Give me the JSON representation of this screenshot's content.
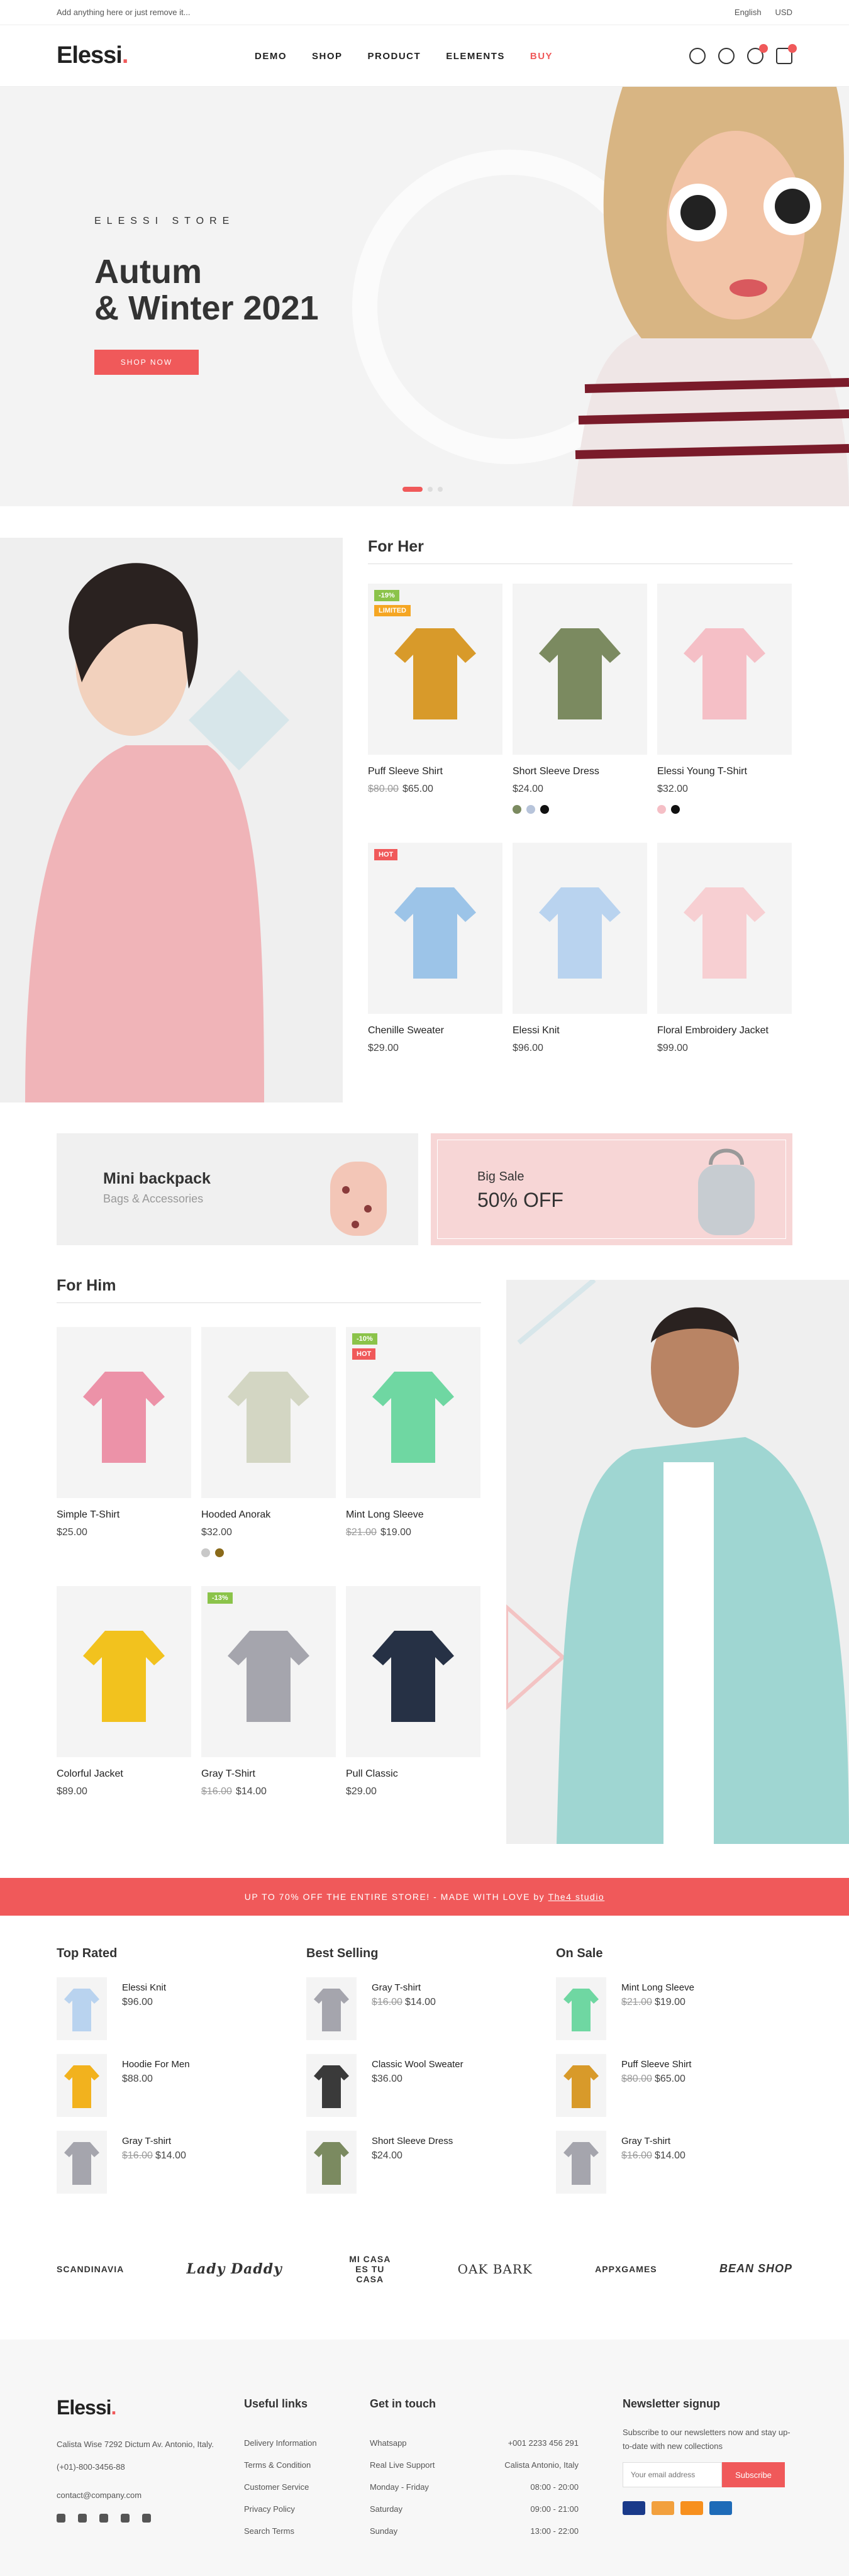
{
  "topbar": {
    "promo": "Add anything here or just remove it...",
    "language": "English",
    "currency": "USD"
  },
  "header": {
    "logo": "Elessi",
    "logo_dot": ".",
    "nav": [
      "DEMO",
      "SHOP",
      "PRODUCT",
      "ELEMENTS",
      "BUY"
    ]
  },
  "hero": {
    "subtitle": "ELESSI STORE",
    "title_line1": "Autum",
    "title_line2": "& Winter 2021",
    "button": "SHOP NOW"
  },
  "for_her": {
    "title": "For Her",
    "products": [
      {
        "name": "Puff Sleeve Shirt",
        "old_price": "$80.00",
        "price": "$65.00",
        "tags": [
          "-19%",
          "LIMITED"
        ],
        "colors": []
      },
      {
        "name": "Short Sleeve Dress",
        "price": "$24.00",
        "tags": [],
        "colors": [
          "#7b8a60",
          "#b7c4da",
          "#111111"
        ]
      },
      {
        "name": "Elessi Young T-Shirt",
        "price": "$32.00",
        "tags": [],
        "colors": [
          "#f5bfc6",
          "#111111"
        ]
      },
      {
        "name": "Chenille Sweater",
        "price": "$29.00",
        "tags": [
          "HOT"
        ],
        "colors": []
      },
      {
        "name": "Elessi Knit",
        "price": "$96.00",
        "tags": [],
        "colors": []
      },
      {
        "name": "Floral Embroidery Jacket",
        "price": "$99.00",
        "tags": [],
        "colors": []
      }
    ]
  },
  "banners": {
    "left_title": "Mini backpack",
    "left_sub": "Bags & Accessories",
    "right_title": "Big Sale",
    "right_sub": "50% OFF"
  },
  "for_him": {
    "title": "For Him",
    "products": [
      {
        "name": "Simple T-Shirt",
        "price": "$25.00",
        "tags": []
      },
      {
        "name": "Hooded Anorak",
        "price": "$32.00",
        "tags": [],
        "colors": [
          "#c8c8c8",
          "#8a6a1a"
        ]
      },
      {
        "name": "Mint Long Sleeve",
        "old_price": "$21.00",
        "price": "$19.00",
        "tags": [
          "-10%",
          "HOT"
        ]
      },
      {
        "name": "Colorful Jacket",
        "price": "$89.00",
        "tags": []
      },
      {
        "name": "Gray T-Shirt",
        "old_price": "$16.00",
        "price": "$14.00",
        "tags": [
          "-13%"
        ]
      },
      {
        "name": "Pull Classic",
        "price": "$29.00",
        "tags": []
      }
    ]
  },
  "strip": {
    "text": "UP TO 70% OFF THE ENTIRE STORE! - MADE WITH LOVE by ",
    "link": "The4 studio"
  },
  "lists": [
    {
      "title": "Top Rated",
      "items": [
        {
          "name": "Elessi Knit",
          "price": "$96.00"
        },
        {
          "name": "Hoodie For Men",
          "price": "$88.00"
        },
        {
          "name": "Gray T-shirt",
          "old": "$16.00",
          "price": "$14.00"
        }
      ]
    },
    {
      "title": "Best Selling",
      "items": [
        {
          "name": "Gray T-shirt",
          "old": "$16.00",
          "price": "$14.00"
        },
        {
          "name": "Classic Wool Sweater",
          "price": "$36.00"
        },
        {
          "name": "Short Sleeve Dress",
          "price": "$24.00"
        }
      ]
    },
    {
      "title": "On Sale",
      "items": [
        {
          "name": "Mint Long Sleeve",
          "old": "$21.00",
          "price": "$19.00"
        },
        {
          "name": "Puff Sleeve Shirt",
          "old": "$80.00",
          "price": "$65.00"
        },
        {
          "name": "Gray T-shirt",
          "old": "$16.00",
          "price": "$14.00"
        }
      ]
    }
  ],
  "brands": [
    "SCANDINAVIA",
    "Lady Daddy",
    "MI CASA ES TU CASA",
    "OAK BARK",
    "APPXGAMES",
    "BEAN SHOP"
  ],
  "footer": {
    "logo": "Elessi",
    "address": "Calista Wise 7292 Dictum Av. Antonio, Italy.",
    "phone": "(+01)-800-3456-88",
    "email": "contact@company.com",
    "useful_title": "Useful links",
    "useful": [
      "Delivery Information",
      "Terms & Condition",
      "Customer Service",
      "Privacy Policy",
      "Search Terms"
    ],
    "touch_title": "Get in touch",
    "touch": [
      [
        "Whatsapp",
        "+001 2233 456 291"
      ],
      [
        "Real Live Support",
        "Calista Antonio, Italy"
      ],
      [
        "Monday - Friday",
        "08:00 - 20:00"
      ],
      [
        "Saturday",
        "09:00 - 21:00"
      ],
      [
        "Sunday",
        "13:00 - 22:00"
      ]
    ],
    "news_title": "Newsletter signup",
    "news_text": "Subscribe to our newsletters now and stay up-to-date with new collections",
    "email_placeholder": "Your email address",
    "subscribe": "Subscribe"
  }
}
